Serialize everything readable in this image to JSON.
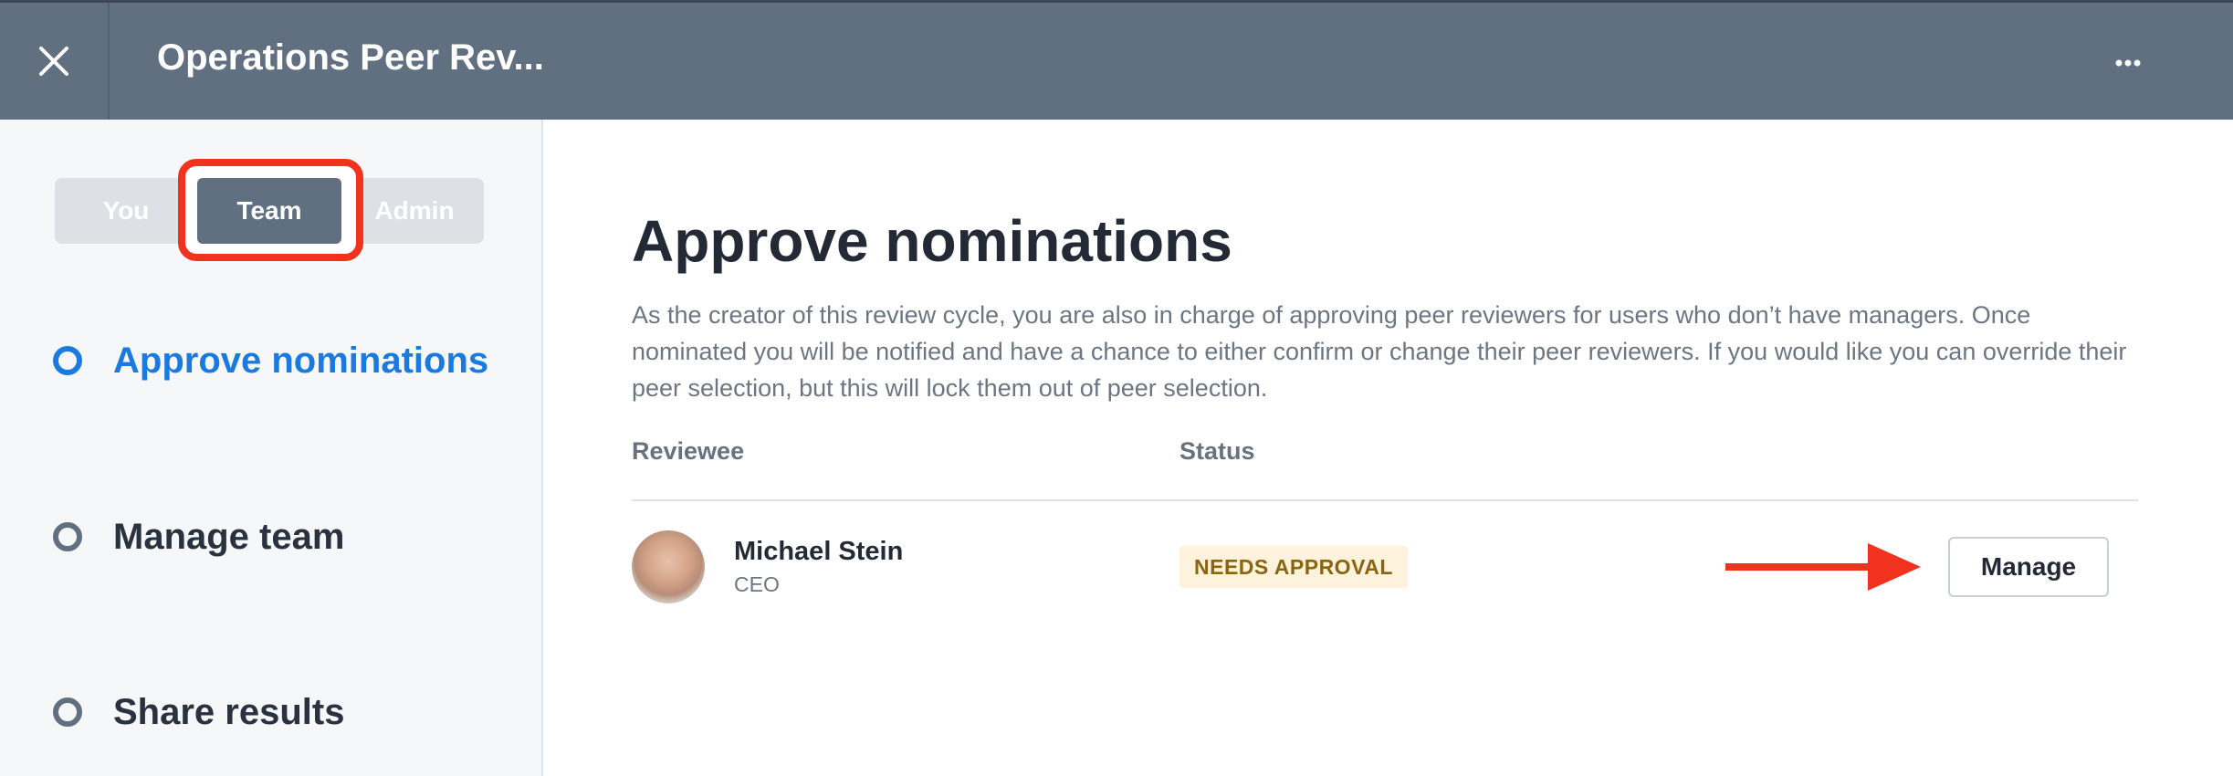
{
  "header": {
    "title": "Operations Peer Rev...",
    "close_icon": "close-icon",
    "more_icon": "more-horizontal-icon"
  },
  "sidebar": {
    "segments": [
      "You",
      "Team",
      "Admin"
    ],
    "active_segment": "Team",
    "steps": [
      {
        "label": "Approve nominations",
        "active": true
      },
      {
        "label": "Manage team",
        "active": false
      },
      {
        "label": "Share results",
        "active": false
      }
    ]
  },
  "main": {
    "title": "Approve nominations",
    "description": "As the creator of this review cycle, you are also in charge of approving peer reviewers for users who don’t have managers. Once nominated you will be notified and have a chance to either confirm or change their peer reviewers. If you would like you can override their peer selection, but this will lock them out of peer selection.",
    "columns": {
      "reviewee": "Reviewee",
      "status": "Status"
    },
    "rows": [
      {
        "name": "Michael Stein",
        "role": "CEO",
        "status": "NEEDS APPROVAL",
        "action": "Manage"
      }
    ]
  },
  "colors": {
    "header_bg": "#617080",
    "accent": "#1a7ae0",
    "highlight": "#f0321f",
    "badge_bg": "#fdf3dc",
    "badge_text": "#8a6410"
  }
}
